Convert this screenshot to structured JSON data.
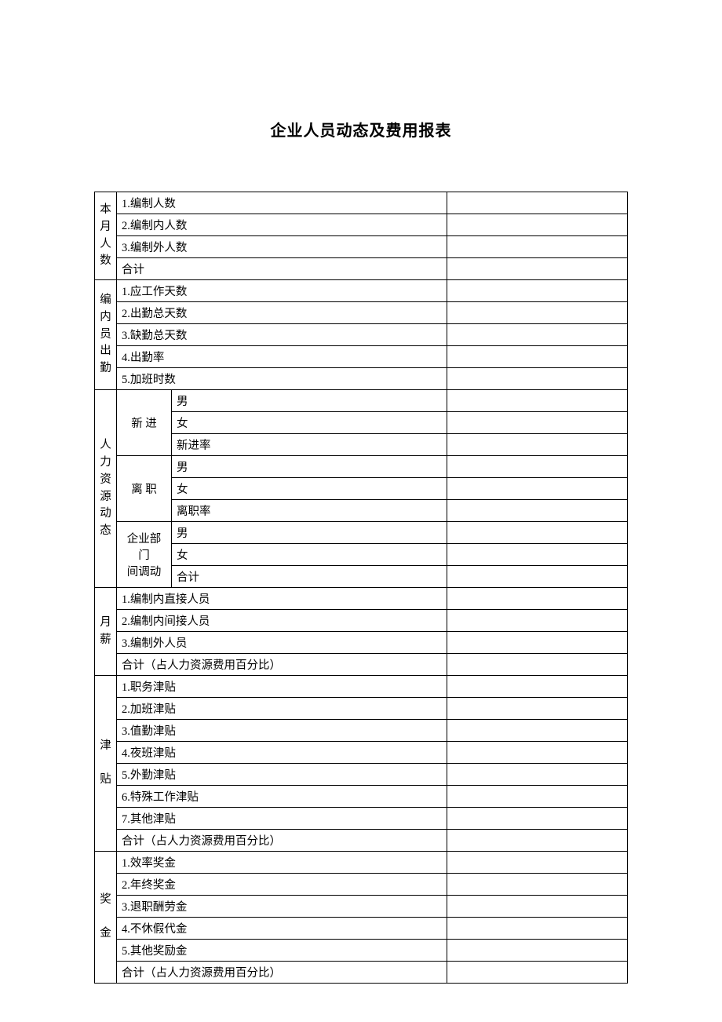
{
  "title": "企业人员动态及费用报表",
  "sections": {
    "s1": {
      "header": "本月人数",
      "rows": [
        "1.编制人数",
        "2.编制内人数",
        "3.编制外人数",
        "合计"
      ]
    },
    "s2": {
      "header": "编内员出勤",
      "rows": [
        "1.应工作天数",
        "2.出勤总天数",
        "3.缺勤总天数",
        "4.出勤率",
        "5.加班时数"
      ]
    },
    "s3": {
      "header": "人力资源动态",
      "groups": {
        "g1": {
          "label": "新 进",
          "rows": [
            "男",
            "女",
            "新进率"
          ]
        },
        "g2": {
          "label": "离 职",
          "rows": [
            "男",
            "女",
            "离职率"
          ]
        },
        "g3": {
          "label_l1": "企业部门",
          "label_l2": "间调动",
          "rows": [
            "男",
            "女",
            "合计"
          ]
        }
      }
    },
    "s4": {
      "header": "月薪",
      "rows": [
        "1.编制内直接人员",
        "2.编制内间接人员",
        "3.编制外人员",
        "合计（占人力资源费用百分比）"
      ]
    },
    "s5": {
      "header": "津贴",
      "rows": [
        "1.职务津贴",
        "2.加班津贴",
        "3.值勤津贴",
        "4.夜班津贴",
        "5.外勤津贴",
        "6.特殊工作津贴",
        "7.其他津贴",
        "合计（占人力资源费用百分比）"
      ]
    },
    "s6": {
      "header": "奖金",
      "rows": [
        "1.效率奖金",
        "2.年终奖金",
        "3.退职酬劳金",
        "4.不休假代金",
        "5.其他奖励金",
        "合计（占人力资源费用百分比）"
      ]
    }
  }
}
